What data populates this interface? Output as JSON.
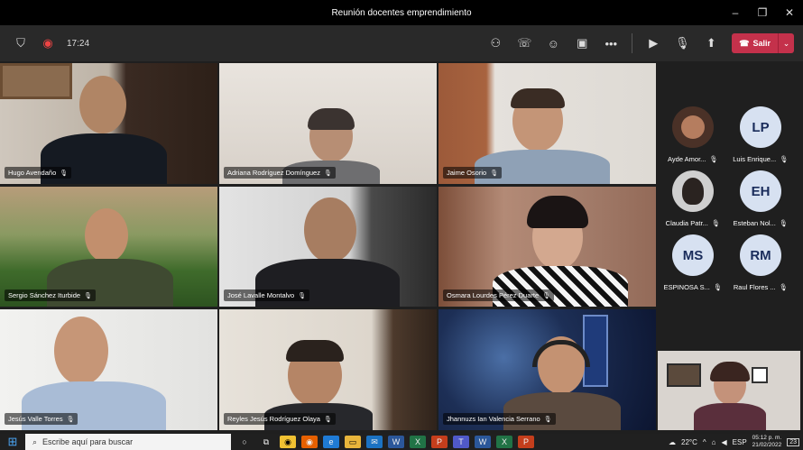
{
  "window": {
    "title": "Reunión docentes emprendimiento"
  },
  "toolbar": {
    "timer": "17:24",
    "leave_label": "Salir"
  },
  "tiles": [
    {
      "name": "Hugo Avendaño"
    },
    {
      "name": "Adriana Rodríguez Domínguez"
    },
    {
      "name": "Jaime Osorio"
    },
    {
      "name": "Sergio Sánchez Iturbide"
    },
    {
      "name": "José Lavalle Montalvo"
    },
    {
      "name": "Osmara Lourdes Pérez Duarte"
    },
    {
      "name": "Jesús Valle Torres"
    },
    {
      "name": "Reyles Jesús Rodríguez Olaya"
    },
    {
      "name": "Jhannuzs Ian Valencia Serrano"
    }
  ],
  "roster": [
    {
      "name": "Ayde Amor...",
      "initials": ""
    },
    {
      "name": "Luis Enrique...",
      "initials": "LP"
    },
    {
      "name": "Claudia Patr...",
      "initials": ""
    },
    {
      "name": "Esteban Nol...",
      "initials": "EH"
    },
    {
      "name": "ESPINOSA S...",
      "initials": "MS"
    },
    {
      "name": "Raul Flores ...",
      "initials": "RM"
    }
  ],
  "taskbar": {
    "search_placeholder": "Escribe aquí para buscar",
    "temperature": "22°C",
    "language": "ESP",
    "time": "05:12 p. m.",
    "date": "21/02/2022",
    "notifications": "23"
  },
  "colors": {
    "leave": "#c4314b",
    "active_outline": "#8b8cc7",
    "avatar_bg": "#d7e1f1"
  }
}
